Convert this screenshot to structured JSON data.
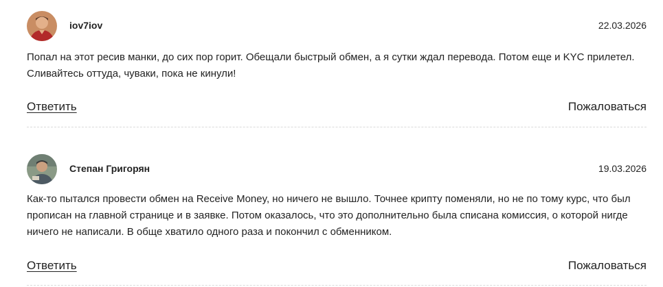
{
  "comments": [
    {
      "author": "iov7iov",
      "date": "22.03.2026",
      "text": "Попал на этот ресив манки, до сих пор горит. Обещали быстрый обмен, а я сутки ждал перевода. Потом еще и KYC прилетел. Сливайтесь оттуда, чуваки, пока не кинули!",
      "reply_label": "Ответить",
      "report_label": "Пожаловаться"
    },
    {
      "author": "Степан Григорян",
      "date": "19.03.2026",
      "text": "Как-то пытался провести обмен на Receive Money, но ничего не вышло. Точнее крипту поменяли, но не по тому курс, что был прописан на главной странице и в заявке. Потом оказалось, что это дополнительно была списана комиссия, о которой нигде ничего не написали. В обще хватило одного раза и покончил с обменником.",
      "reply_label": "Ответить",
      "report_label": "Пожаловаться"
    }
  ],
  "icons": {
    "avatar_1": "user-avatar-photo",
    "avatar_2": "user-avatar-photo"
  },
  "colors": {
    "text": "#222222",
    "divider": "#d9d9d9"
  }
}
